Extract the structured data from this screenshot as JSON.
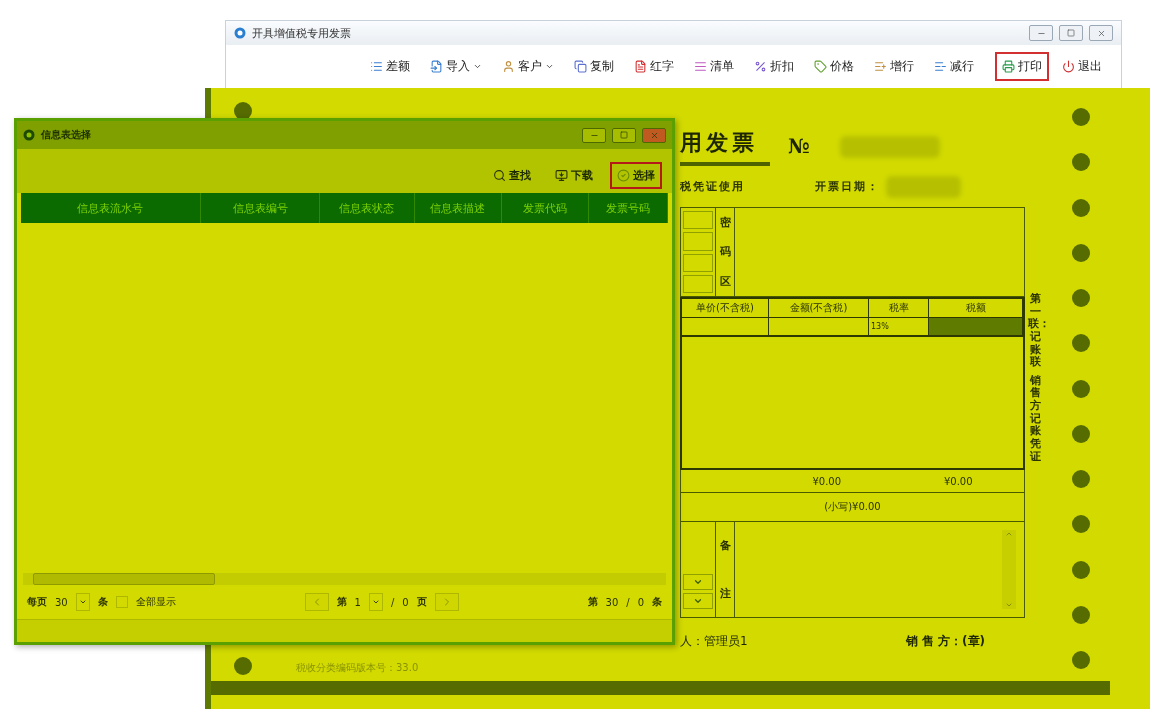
{
  "main_window": {
    "title": "开具增值税专用发票",
    "toolbar": [
      {
        "kind": "list",
        "label": "差额",
        "dropdown": false,
        "highlighted": false
      },
      {
        "kind": "import",
        "label": "导入",
        "dropdown": true,
        "highlighted": false
      },
      {
        "kind": "user",
        "label": "客户",
        "dropdown": true,
        "highlighted": false
      },
      {
        "kind": "copy",
        "label": "复制",
        "dropdown": false,
        "highlighted": false
      },
      {
        "kind": "red",
        "label": "红字",
        "dropdown": false,
        "highlighted": false
      },
      {
        "kind": "lines",
        "label": "清单",
        "dropdown": false,
        "highlighted": false
      },
      {
        "kind": "discount",
        "label": "折扣",
        "dropdown": false,
        "highlighted": false
      },
      {
        "kind": "price",
        "label": "价格",
        "dropdown": false,
        "highlighted": false
      },
      {
        "kind": "addrow",
        "label": "增行",
        "dropdown": false,
        "highlighted": false
      },
      {
        "kind": "delrow",
        "label": "减行",
        "dropdown": false,
        "highlighted": false
      },
      {
        "kind": "print",
        "label": "打印",
        "dropdown": false,
        "highlighted": true
      },
      {
        "kind": "exit",
        "label": "退出",
        "dropdown": false,
        "highlighted": false
      }
    ]
  },
  "invoice": {
    "title": "用发票",
    "number_label": "№",
    "usage": "税凭证使用",
    "date_label": "开票日期：",
    "cipher_label": [
      "密",
      "码",
      "区"
    ],
    "columns": [
      "单价(不含税)",
      "金额(不含税)",
      "税率",
      "税额"
    ],
    "row": {
      "tax_rate": "13%"
    },
    "totals": [
      "¥0.00",
      "¥0.00"
    ],
    "amount_small": "(小写)¥0.00",
    "remarks_label": [
      "备",
      "注"
    ],
    "drawer": "人：管理员1",
    "seller": "销 售 方：(章)",
    "copy_label": [
      "第一联：记账联",
      "销售方记账凭证"
    ],
    "footer": "税收分类编码版本号：33.0"
  },
  "dialog": {
    "title": "信息表选择",
    "toolbar": [
      {
        "kind": "search",
        "label": "查找",
        "highlighted": false
      },
      {
        "kind": "download",
        "label": "下载",
        "highlighted": false
      },
      {
        "kind": "select",
        "label": "选择",
        "highlighted": true
      }
    ],
    "table": {
      "columns": [
        "信息表流水号",
        "信息表编号",
        "信息表状态",
        "信息表描述",
        "发票代码",
        "发票号码"
      ]
    },
    "pager": {
      "per_page_label": "每页",
      "per_page": "30",
      "per_page_unit": "条",
      "show_all": {
        "label": "全部显示",
        "checked": false
      },
      "page_prefix": "第",
      "page": "1",
      "page_sep": "/",
      "page_total": "0",
      "page_unit": "页",
      "record_prefix": "第",
      "record": "30",
      "record_sep": "/",
      "record_total": "0",
      "record_unit": "条"
    }
  }
}
